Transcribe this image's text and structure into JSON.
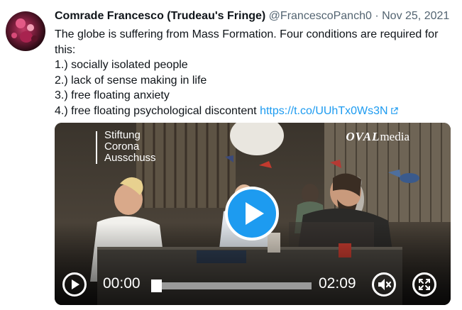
{
  "tweet": {
    "display_name": "Comrade Francesco (Trudeau's Fringe)",
    "handle": "@FrancescoPanch0",
    "separator": "·",
    "date": "Nov 25, 2021",
    "text_lines": [
      "The globe is suffering from Mass Formation. Four conditions are required for",
      "this:",
      "1.) socially isolated people",
      "2.) lack of sense making in life",
      "3.) free floating anxiety",
      "4.) free floating psychological discontent "
    ],
    "link_text": "https://t.co/UUhTx0Ws3N",
    "link_icon": "external-link-icon"
  },
  "video": {
    "watermark_left": [
      "Stiftung",
      "Corona",
      "Ausschuss"
    ],
    "watermark_right_brand": "OVAL",
    "watermark_right_suffix": "media",
    "current_time": "00:00",
    "duration": "02:09",
    "progress_fraction": 0.0,
    "icons": {
      "center": "play-icon",
      "play": "play-icon",
      "mute": "speaker-muted-icon",
      "fullscreen": "fullscreen-icon"
    }
  },
  "colors": {
    "link": "#1d9bf0",
    "play_button": "#1d9bf0",
    "secondary_text": "#536471"
  }
}
